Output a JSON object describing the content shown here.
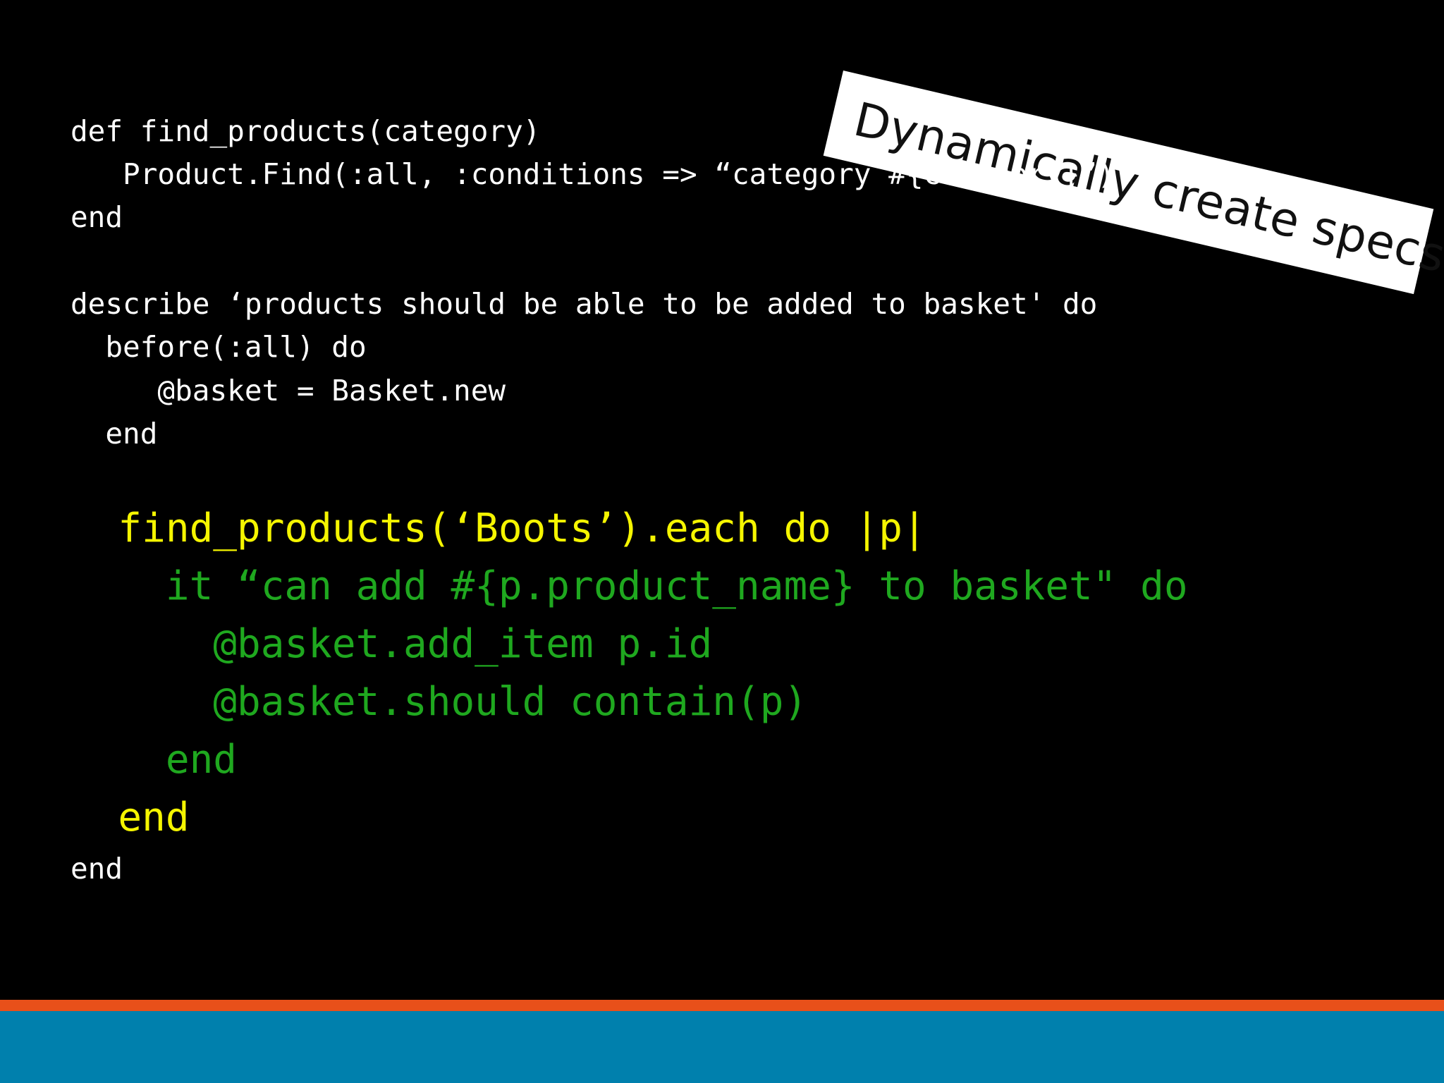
{
  "slide": {
    "label": "Dynamically create specs",
    "code": {
      "helper": [
        "def find_products(category)",
        "   Product.Find(:all, :conditions => “category #{category}”)",
        "end"
      ],
      "describe": [
        "describe ‘products should be able to be added to basket' do",
        "  before(:all) do",
        "     @basket = Basket.new",
        "  end"
      ],
      "loop_open": "  find_products(‘Boots’).each do |p|",
      "it_block": [
        "    it “can add #{p.product_name} to basket\" do",
        "      @basket.add_item p.id",
        "      @basket.should contain(p)",
        "    end"
      ],
      "loop_close": "  end",
      "final_end": "end"
    },
    "colors": {
      "background": "#000000",
      "code_text": "#ffffff",
      "loop_highlight": "#f5f500",
      "spec_highlight": "#1fa81f",
      "accent_strip": "#e8501a",
      "footer_bar": "#0080ad"
    }
  }
}
